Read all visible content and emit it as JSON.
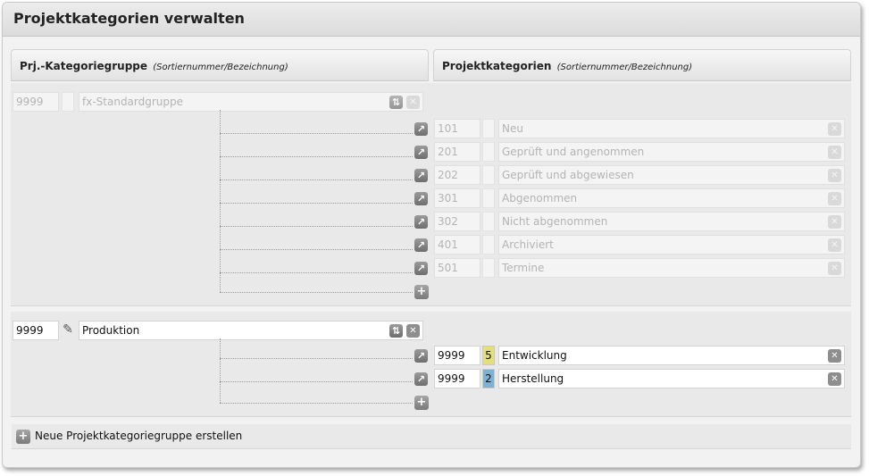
{
  "title": "Projektkategorien verwalten",
  "left_header": {
    "label": "Prj.-Kategoriegruppe",
    "sub": "(Sortiernummer/Bezeichnung)"
  },
  "right_header": {
    "label": "Projektkategorien",
    "sub": "(Sortiernummer/Bezeichnung)"
  },
  "groups": [
    {
      "sort": "9999",
      "name": "fx-Standardgruppe",
      "categories": [
        {
          "sort": "101",
          "name": "Neu"
        },
        {
          "sort": "201",
          "name": "Geprüft und angenommen"
        },
        {
          "sort": "202",
          "name": "Geprüft und abgewiesen"
        },
        {
          "sort": "301",
          "name": "Abgenommen"
        },
        {
          "sort": "302",
          "name": "Nicht abgenommen"
        },
        {
          "sort": "401",
          "name": "Archiviert"
        },
        {
          "sort": "501",
          "name": "Termine"
        }
      ]
    },
    {
      "sort": "9999",
      "name": "Produktion",
      "categories": [
        {
          "sort": "9999",
          "badge": "5",
          "badge_color": "#e3df7a",
          "name": "Entwicklung"
        },
        {
          "sort": "9999",
          "badge": "2",
          "badge_color": "#7fb1d4",
          "name": "Herstellung"
        }
      ]
    }
  ],
  "new_group_label": "Neue Projektkategoriegruppe erstellen",
  "icons": {
    "move": "move-arrow-icon",
    "sort": "sort-icon",
    "delete": "close-icon",
    "add": "plus-icon",
    "edit": "pencil-icon"
  }
}
